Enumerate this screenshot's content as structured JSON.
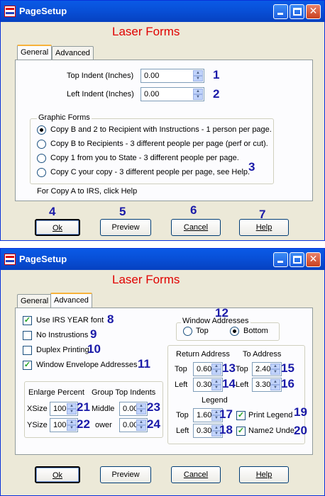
{
  "window1": {
    "title": "PageSetup",
    "heading": "Laser Forms",
    "tabs": [
      "General",
      "Advanced"
    ],
    "top_indent_label": "Top Indent (Inches)",
    "top_indent_value": "0.00",
    "left_indent_label": "Left Indent (Inches)",
    "left_indent_value": "0.00",
    "graphic_forms_title": "Graphic Forms",
    "options": [
      "Copy B and 2 to Recipient with Instructions - 1 person per page.",
      "Copy B to Recipients - 3 different people per page (perf or cut).",
      "Copy 1 from you to State - 3 different people per page.",
      "Copy C your copy - 3 different people per page, see Help."
    ],
    "footer_note": "For Copy A to IRS, click Help",
    "buttons": {
      "ok": "Ok",
      "preview": "Preview",
      "cancel": "Cancel",
      "help": "Help"
    },
    "numbers": [
      "1",
      "2",
      "3",
      "4",
      "5",
      "6",
      "7"
    ]
  },
  "window2": {
    "title": "PageSetup",
    "heading": "Laser Forms",
    "tabs": [
      "General",
      "Advanced"
    ],
    "checks": {
      "irs_year_font": "Use IRS YEAR font",
      "no_instructions": "No Instrustions",
      "duplex": "Duplex Printing",
      "window_envelope": "Window Envelope Addresses"
    },
    "window_addresses_title": "Window Addresses",
    "radio_top": "Top",
    "radio_bottom": "Bottom",
    "enlarge_percent_label": "Enlarge Percent",
    "group_top_indents_label": "Group Top Indents",
    "xsize_label": "XSize",
    "xsize_value": "100",
    "ysize_label": "YSize",
    "ysize_value": "100",
    "middle_label": "Middle",
    "middle_value": "0.00",
    "lower_label": "ower",
    "lower_value": "0.00",
    "return_address_label": "Return Address",
    "to_address_label": "To Address",
    "ret_top_label": "Top",
    "ret_top_value": "0.60",
    "ret_left_label": "Left",
    "ret_left_value": "0.30",
    "to_top_label": "Top",
    "to_top_value": "2.40",
    "to_left_label": "Left",
    "to_left_value": "3.30",
    "legend_label": "Legend",
    "leg_top_label": "Top",
    "leg_top_value": "1.60",
    "leg_left_label": "Left",
    "leg_left_value": "0.30",
    "print_legend": "Print Legend",
    "name2_under": "Name2 Unde",
    "buttons": {
      "ok": "Ok",
      "preview": "Preview",
      "cancel": "Cancel",
      "help": "Help"
    },
    "numbers": [
      "8",
      "9",
      "10",
      "11",
      "12",
      "13",
      "14",
      "15",
      "16",
      "17",
      "18",
      "19",
      "20",
      "21",
      "22",
      "23",
      "24"
    ]
  }
}
